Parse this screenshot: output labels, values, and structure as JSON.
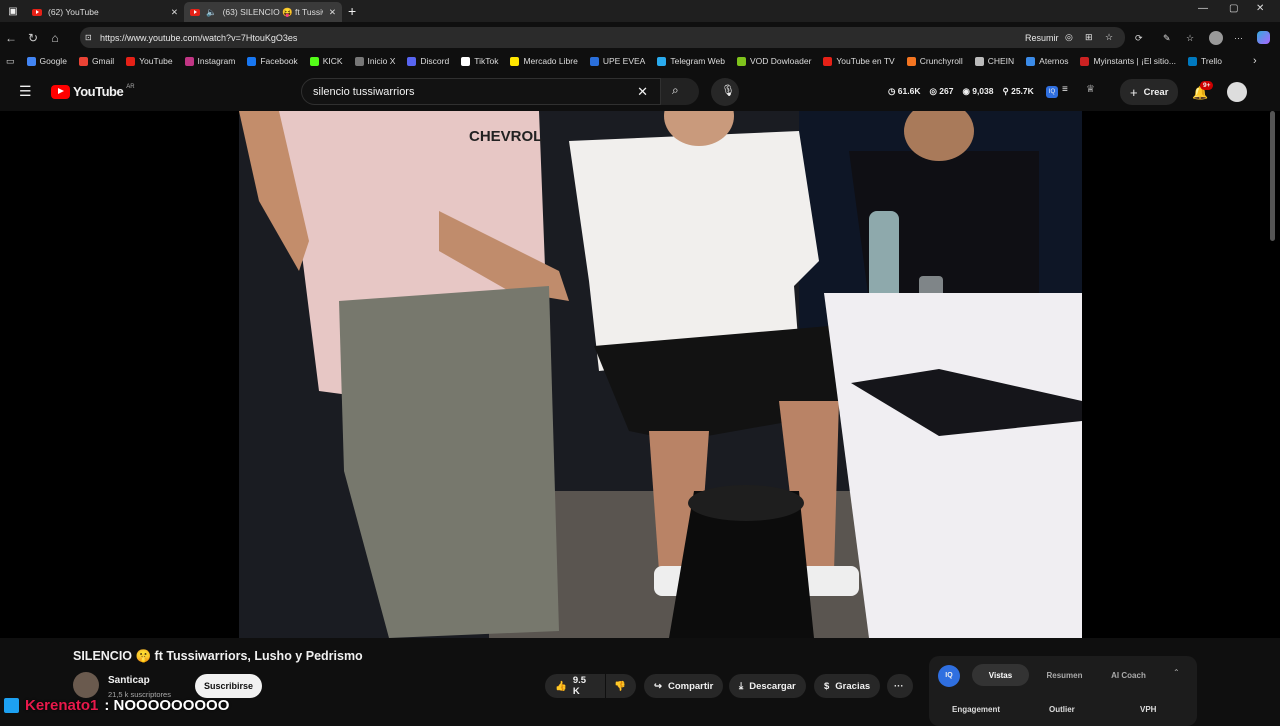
{
  "browser": {
    "tabs": [
      {
        "label": "(62) YouTube",
        "active": false
      },
      {
        "label": "(63) SILENCIO 😝 ft Tussiwa",
        "active": true
      }
    ],
    "url": "https://www.youtube.com/watch?v=7HtouKgO3es",
    "resumir_label": "Resumir",
    "bookmarks": [
      {
        "label": "Google",
        "color": "#4285f4"
      },
      {
        "label": "Gmail",
        "color": "#ea4335"
      },
      {
        "label": "YouTube",
        "color": "#e62117"
      },
      {
        "label": "Instagram",
        "color": "#c13584"
      },
      {
        "label": "Facebook",
        "color": "#1877f2"
      },
      {
        "label": "KICK",
        "color": "#53fc18"
      },
      {
        "label": "Inicio X",
        "color": "#777777"
      },
      {
        "label": "Discord",
        "color": "#5865f2"
      },
      {
        "label": "TikTok",
        "color": "#ffffff"
      },
      {
        "label": "Mercado Libre",
        "color": "#ffe600"
      },
      {
        "label": "UPE EVEA",
        "color": "#2a6fdb"
      },
      {
        "label": "Telegram Web",
        "color": "#2aabee"
      },
      {
        "label": "VOD Dowloader",
        "color": "#7fc31c"
      },
      {
        "label": "YouTube en TV",
        "color": "#e62117"
      },
      {
        "label": "Crunchyroll",
        "color": "#f47521"
      },
      {
        "label": "CHEIN",
        "color": "#bbbbbb"
      },
      {
        "label": "Aternos",
        "color": "#3b8be8"
      },
      {
        "label": "Myinstants | ¡El sitio...",
        "color": "#cc2222"
      },
      {
        "label": "Trello",
        "color": "#0079bf"
      }
    ]
  },
  "youtube": {
    "logo": "YouTube",
    "region": "AR",
    "search_query": "silencio tussiwarriors",
    "stats": [
      "61.6K",
      "267",
      "9,038",
      "25.7K"
    ],
    "create_label": "Crear",
    "notif_badge": "9+"
  },
  "video": {
    "title": "SILENCIO 🤫 ft Tussiwarriors, Lusho y Pedrismo",
    "channel": "Santicap",
    "subscribers": "21,5 k suscriptores",
    "subscribe_label": "Suscribirse",
    "likes": "9.5 K",
    "share_label": "Compartir",
    "download_label": "Descargar",
    "thanks_label": "Gracias"
  },
  "ext_panel": {
    "tabs": [
      "Vistas",
      "Resumen",
      "AI Coach"
    ],
    "columns": [
      "Engagement",
      "Outlier",
      "VPH"
    ]
  },
  "overlay": {
    "user": "Kerenato1",
    "message": ": NOOOOOOOOO"
  }
}
